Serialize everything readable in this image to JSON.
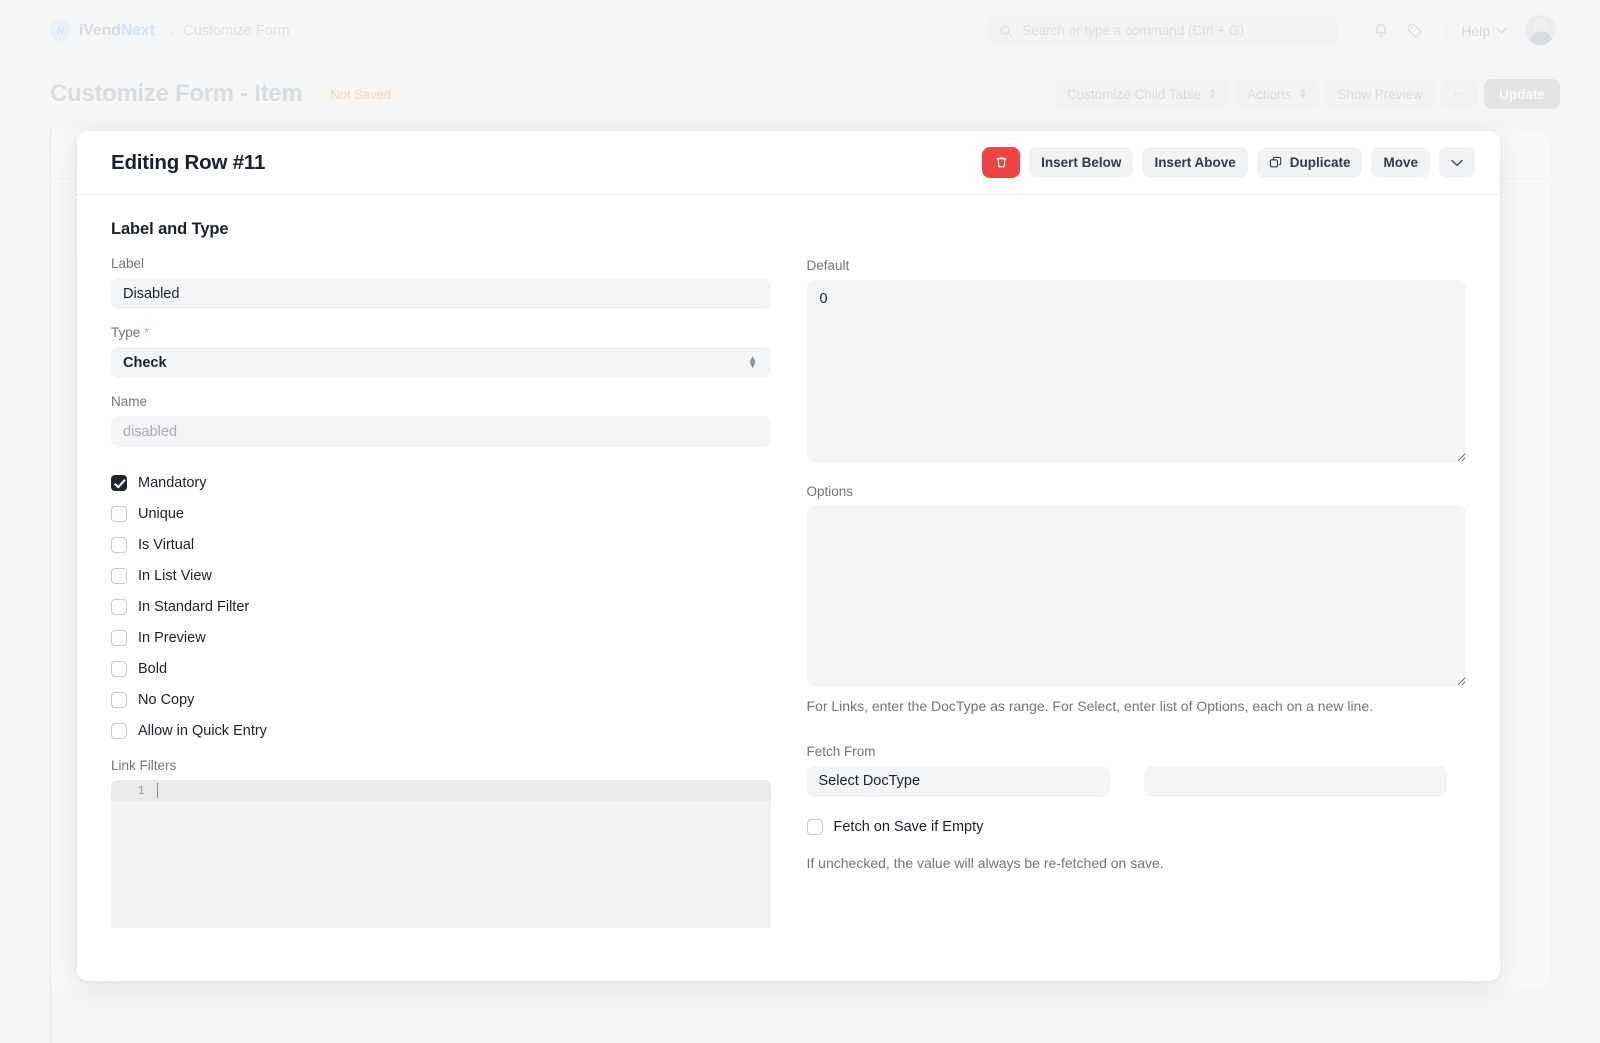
{
  "navbar": {
    "brand_mark": "logo-icon",
    "brand_primary": "iVend",
    "brand_accent": "Next",
    "breadcrumb_separator": "›",
    "breadcrumb": "Customize Form",
    "search_placeholder": "Search or type a command (Ctrl + G)",
    "notifications_icon": "bell-icon",
    "tag_icon": "tag-icon",
    "help_label": "Help",
    "help_chevron": "⌄",
    "avatar": "user-avatar"
  },
  "pagehead": {
    "title": "Customize Form - Item",
    "status_badge": "Not Saved",
    "actions": {
      "customize_child_table": "Customize Child Table",
      "actions": "Actions",
      "show_preview": "Show Preview",
      "more": "⋯",
      "update": "Update"
    }
  },
  "modal": {
    "title": "Editing Row #11",
    "buttons": {
      "delete_icon": "trash-icon",
      "insert_below": "Insert Below",
      "insert_above": "Insert Above",
      "duplicate_icon": "copy-icon",
      "duplicate": "Duplicate",
      "move": "Move",
      "chevron": "⌄"
    },
    "left": {
      "section_title": "Label and Type",
      "label_field": {
        "label": "Label",
        "value": "Disabled"
      },
      "type_field": {
        "label": "Type",
        "required_marker": "*",
        "value": "Check"
      },
      "name_field": {
        "label": "Name",
        "value": "",
        "placeholder": "disabled"
      },
      "checkboxes": [
        {
          "label": "Mandatory",
          "checked": true
        },
        {
          "label": "Unique",
          "checked": false
        },
        {
          "label": "Is Virtual",
          "checked": false
        },
        {
          "label": "In List View",
          "checked": false
        },
        {
          "label": "In Standard Filter",
          "checked": false
        },
        {
          "label": "In Preview",
          "checked": false
        },
        {
          "label": "Bold",
          "checked": false
        },
        {
          "label": "No Copy",
          "checked": false
        },
        {
          "label": "Allow in Quick Entry",
          "checked": false
        }
      ],
      "link_filters": {
        "label": "Link Filters",
        "line_number": "1",
        "value": ""
      }
    },
    "right": {
      "default_field": {
        "label": "Default",
        "value": "0"
      },
      "options_field": {
        "label": "Options",
        "value": ""
      },
      "options_help": "For Links, enter the DocType as range. For Select, enter list of Options, each on a new line.",
      "fetch_from": {
        "label": "Fetch From",
        "doctype_value": "Select DocType",
        "field_value": "",
        "checkbox_label": "Fetch on Save if Empty",
        "checkbox_checked": false,
        "help": "If unchecked, the value will always be re-fetched on save."
      }
    }
  },
  "colors": {
    "danger": "#ef4444",
    "accent": "#8ab4f0",
    "badge_text": "#c9a169",
    "input_bg": "#f3f4f5"
  }
}
